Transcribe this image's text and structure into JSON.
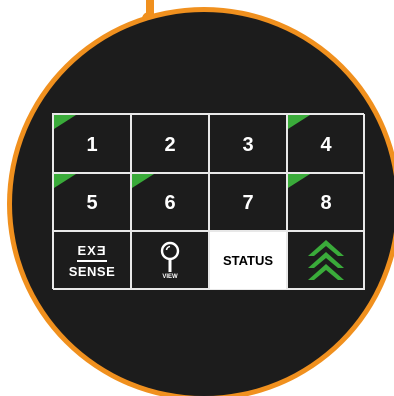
{
  "keypad": {
    "keys": [
      {
        "label": "1",
        "active": true
      },
      {
        "label": "2",
        "active": false
      },
      {
        "label": "3",
        "active": false
      },
      {
        "label": "4",
        "active": true
      },
      {
        "label": "5",
        "active": true
      },
      {
        "label": "6",
        "active": true
      },
      {
        "label": "7",
        "active": false
      },
      {
        "label": "8",
        "active": true
      }
    ],
    "logo_top": "EXƎ",
    "logo_bottom": "SENSE",
    "view_label": "VIEW",
    "status_label": "STATUS"
  },
  "colors": {
    "accent": "#3aab3a",
    "ring": "#f0901e",
    "panel": "#1c1c1c"
  },
  "icons": {
    "view": "magnifier-icon",
    "up": "double-chevron-up-icon"
  }
}
